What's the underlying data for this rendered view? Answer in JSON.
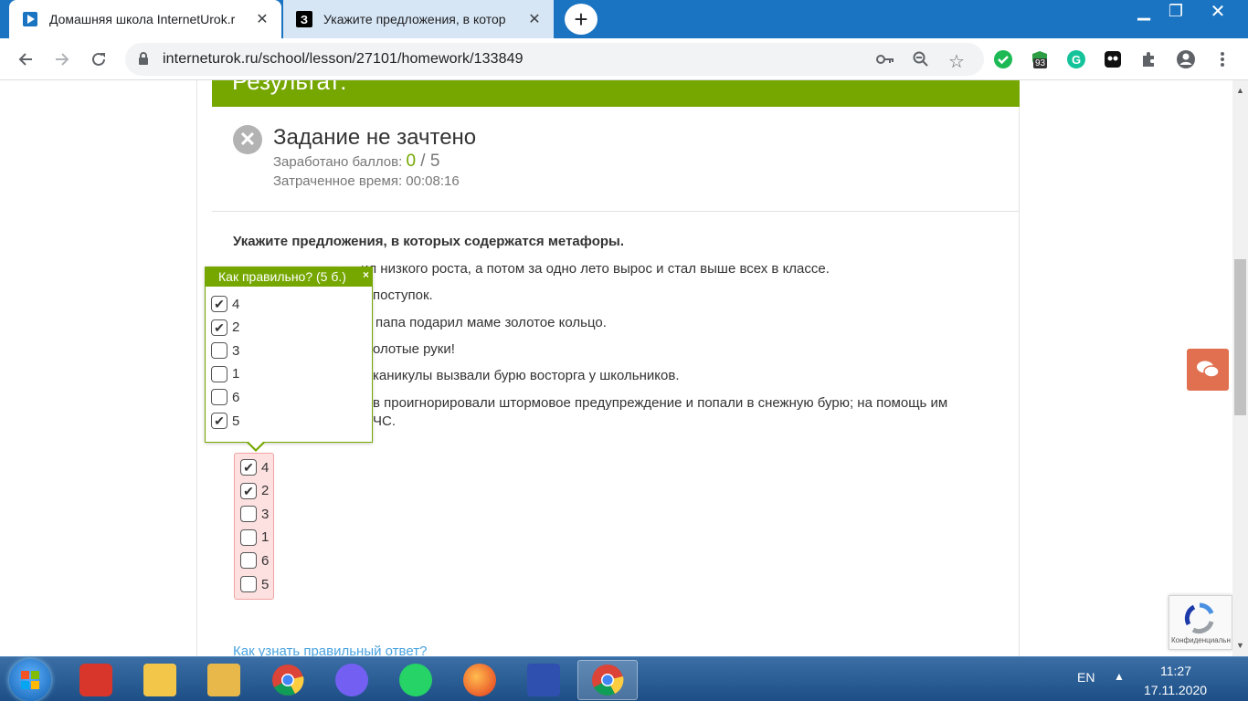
{
  "browser": {
    "tabs": [
      {
        "title": "Домашняя школа InternetUrok.r",
        "active": true
      },
      {
        "title": "Укажите предложения, в котор",
        "active": false
      }
    ],
    "tab2_favicon_letter": "З",
    "new_tab_symbol": "+",
    "url": "interneturok.ru/school/lesson/27101/homework/133849",
    "extension_badge": "93",
    "window_buttons": {
      "minimize": "▁",
      "restore": "❐",
      "close": "✕"
    }
  },
  "page": {
    "result_header": "Результат:",
    "status_title": "Задание не зачтено",
    "score_label": "Заработано баллов:",
    "score_earned": "0",
    "score_separator": " / ",
    "score_total": "5",
    "time_label": "Затраченное время: 00:08:16",
    "question": "Укажите предложения, в которых содержатся метафоры.",
    "sentences": [
      "ил низкого роста, а потом за одно лето вырос и стал выше всех в классе.",
      "поступок.",
      "папа подарил маме золотое кольцо.",
      "олотые руки!",
      "каникулы вызвали бурю восторга у школьников.",
      "в проигнорировали штормовое предупреждение и попали в снежную бурю; на помощь им",
      "ЧС."
    ],
    "user_answers": [
      {
        "label": "4",
        "checked": true
      },
      {
        "label": "2",
        "checked": true
      },
      {
        "label": "3",
        "checked": false
      },
      {
        "label": "1",
        "checked": false
      },
      {
        "label": "6",
        "checked": false
      },
      {
        "label": "5",
        "checked": false
      }
    ],
    "popup": {
      "title": "Как правильно? (5 б.)",
      "close": "×",
      "options": [
        {
          "label": "4",
          "checked": true
        },
        {
          "label": "2",
          "checked": true
        },
        {
          "label": "3",
          "checked": false
        },
        {
          "label": "1",
          "checked": false
        },
        {
          "label": "6",
          "checked": false
        },
        {
          "label": "5",
          "checked": true
        }
      ]
    },
    "help_link": "Как узнать правильный ответ?",
    "recaptcha_text": "Конфиденциальн"
  },
  "taskbar": {
    "language": "EN",
    "tray_arrow": "▲",
    "time": "11:27",
    "date": "17.11.2020"
  },
  "colors": {
    "green": "#75a700",
    "taskbar": "#1d4f86",
    "tabstrip": "#1a74c2",
    "link": "#4aa3df",
    "chat": "#e07050"
  }
}
